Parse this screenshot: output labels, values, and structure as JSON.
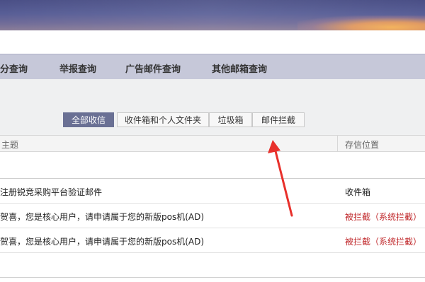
{
  "nav": {
    "items": [
      "分查询",
      "举报查询",
      "广告邮件查询",
      "其他邮箱查询"
    ]
  },
  "tabs": [
    {
      "label": "全部收信",
      "active": true
    },
    {
      "label": "收件箱和个人文件夹",
      "active": false
    },
    {
      "label": "垃圾箱",
      "active": false
    },
    {
      "label": "邮件拦截",
      "active": false
    }
  ],
  "table": {
    "headers": {
      "subject": "主题",
      "location": "存信位置"
    },
    "rows": [
      {
        "subject": "注册锐竞采购平台验证邮件",
        "location": "收件箱",
        "location_color": "#222222"
      },
      {
        "subject": "贺喜，您是核心用户，请申请属于您的新版pos机(AD)",
        "location": "被拦截（系统拦截）",
        "location_color": "#c0282b"
      },
      {
        "subject": "贺喜，您是核心用户，请申请属于您的新版pos机(AD)",
        "location": "被拦截（系统拦截）",
        "location_color": "#c0282b"
      }
    ]
  },
  "colors": {
    "active_tab": "#6a7094",
    "nav_bg": "#c6c8d9",
    "arrow": "#e8302b"
  }
}
